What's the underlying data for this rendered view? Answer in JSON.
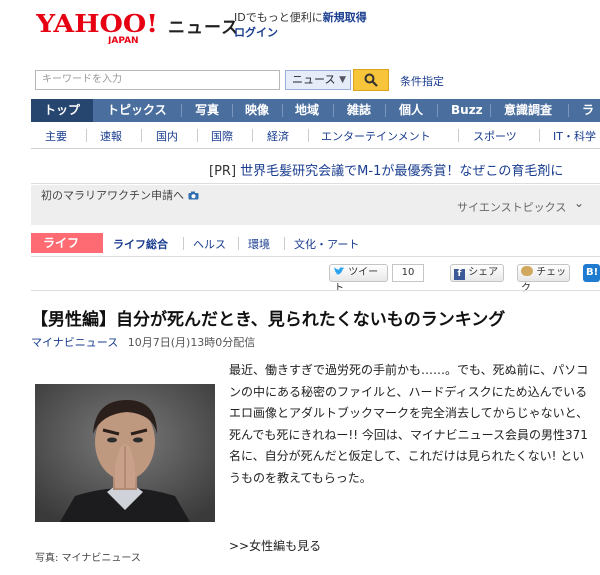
{
  "header": {
    "logo_text": "YAHOO! JAPAN",
    "logo_main": "YAHOO!",
    "logo_sub": "JAPAN",
    "service_title": "ニュース",
    "promo_text": "IDでもっと便利に",
    "register_link": "新規取得",
    "login_link": "ログイン"
  },
  "search": {
    "placeholder": "キーワードを入力",
    "category": "ニュース",
    "condition_link": "条件指定"
  },
  "main_nav": [
    "トップ",
    "トピックス",
    "写真",
    "映像",
    "地域",
    "雑誌",
    "個人",
    "Buzz",
    "意識調査",
    "ラン"
  ],
  "sub_nav": [
    "主要",
    "速報",
    "国内",
    "国際",
    "経済",
    "エンターテインメント",
    "スポーツ",
    "IT・科学"
  ],
  "pr": {
    "tag": "[PR]",
    "text": "世界毛髪研究会議でM-1が最優秀賞！なぜこの育毛剤に"
  },
  "science_box": {
    "text": "初のマラリアワクチン申請へ",
    "topic_label": "サイエンストピックス"
  },
  "life_nav": {
    "tag": "ライフ",
    "items": [
      "ライフ総合",
      "ヘルス",
      "環境",
      "文化・アート"
    ]
  },
  "social": {
    "tweet_label": "ツイート",
    "tweet_count": "10",
    "facebook_label": "シェア",
    "mixi_label": "チェック",
    "hatena_label": "B!"
  },
  "article": {
    "headline": "【男性編】自分が死んだとき、見られたくないものランキング",
    "source": "マイナビニュース",
    "date": "10月7日(月)13時0分配信",
    "body": "最近、働きすぎで過労死の手前かも……。でも、死ぬ前に、パソコンの中にある秘密のファイルと、ハードディスクにため込んでいるエロ画像とアダルトブックマークを完全消去してからじゃないと、死んでも死にきれねー!! 今回は、マイナビニュース会員の男性371名に、自分が死んだと仮定して、これだけは見られたくない! というものを教えてもらった。",
    "photo_caption": "写真: マイナビニュース",
    "more_link": ">>女性編も見る"
  },
  "colors": {
    "nav_bg": "#4a6f9e",
    "nav_active": "#26456f",
    "link": "#1a3d8f",
    "life_tag": "#ff6b72",
    "logo_red": "#e60012",
    "search_button": "#f8c43a"
  }
}
